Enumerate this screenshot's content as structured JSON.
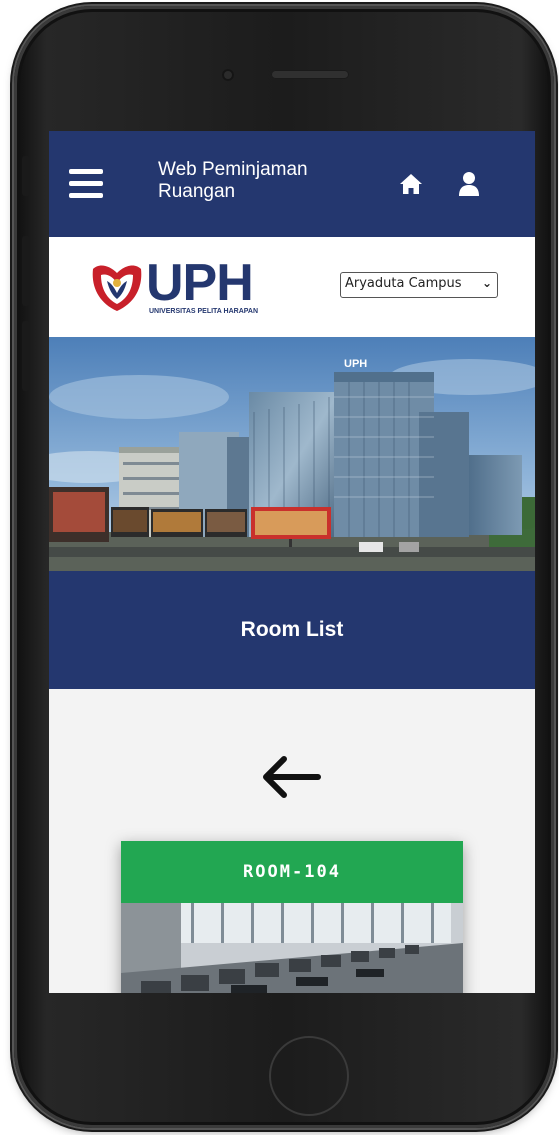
{
  "header": {
    "title": "Web Peminjaman Ruangan",
    "menu_icon": "hamburger-menu-icon",
    "home_icon": "home-icon",
    "user_icon": "user-icon"
  },
  "brand": {
    "logo_text": "UPH",
    "logo_subtitle": "UNIVERSITAS PELITA HARAPAN",
    "banner_sign": "UPH"
  },
  "campus_select": {
    "selected": "Aryaduta Campus"
  },
  "section": {
    "title": "Room List",
    "back_icon": "arrow-left-icon"
  },
  "rooms": [
    {
      "name": "ROOM-104"
    }
  ],
  "colors": {
    "primary": "#24376f",
    "room_header": "#22a752",
    "background": "#f3f3f3"
  }
}
